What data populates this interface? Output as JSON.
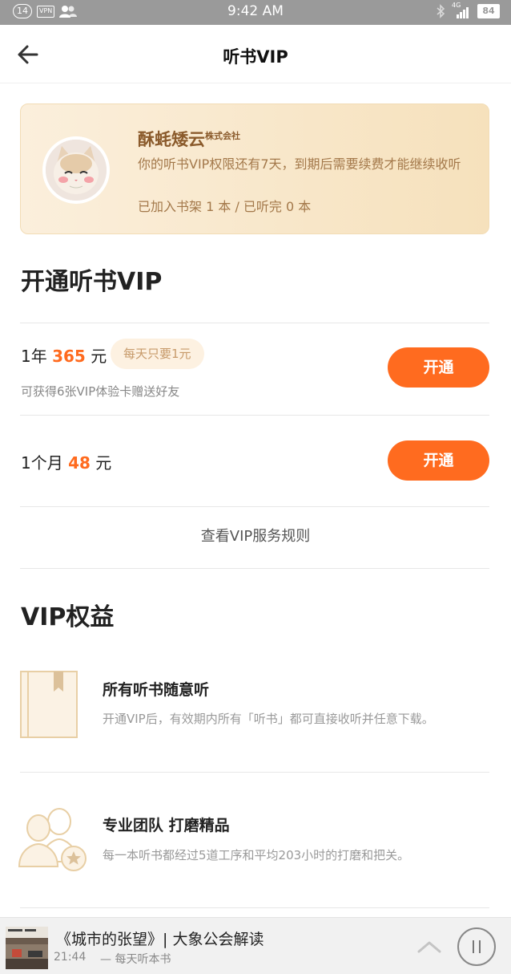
{
  "status_bar": {
    "notification_count": "14",
    "vpn": "VPN",
    "time": "9:42 AM",
    "network": "4G",
    "battery": "84"
  },
  "header": {
    "title": "听书VIP"
  },
  "profile": {
    "name": "酥蚝矮云",
    "name_suffix": "株式会社",
    "description": "你的听书VIP权限还有7天，到期后需要续费才能继续收听",
    "stats": "已加入书架 1 本 / 已听完 0 本"
  },
  "open_vip": {
    "title": "开通听书VIP",
    "plans": [
      {
        "duration": "1年",
        "price": "365",
        "unit": "元",
        "tag": "每天只要1元",
        "subtitle": "可获得6张VIP体验卡赠送好友",
        "button": "开通"
      },
      {
        "duration": "1个月",
        "price": "48",
        "unit": "元",
        "button": "开通"
      }
    ],
    "rules_link": "查看VIP服务规则"
  },
  "benefits": {
    "title": "VIP权益",
    "items": [
      {
        "icon": "book-icon",
        "title": "所有听书随意听",
        "description": "开通VIP后，有效期内所有「听书」都可直接收听并任意下载。"
      },
      {
        "icon": "team-star-icon",
        "title": "专业团队 打磨精品",
        "description": "每一本听书都经过5道工序和平均203小时的打磨和把关。"
      }
    ]
  },
  "player": {
    "title": "《城市的张望》| 大象公会解读",
    "time": "21:44",
    "subtitle": "— 每天听本书"
  },
  "colors": {
    "accent": "#ff6b1f",
    "card_text": "#a3784a",
    "card_bg": "#f6e1bc"
  }
}
